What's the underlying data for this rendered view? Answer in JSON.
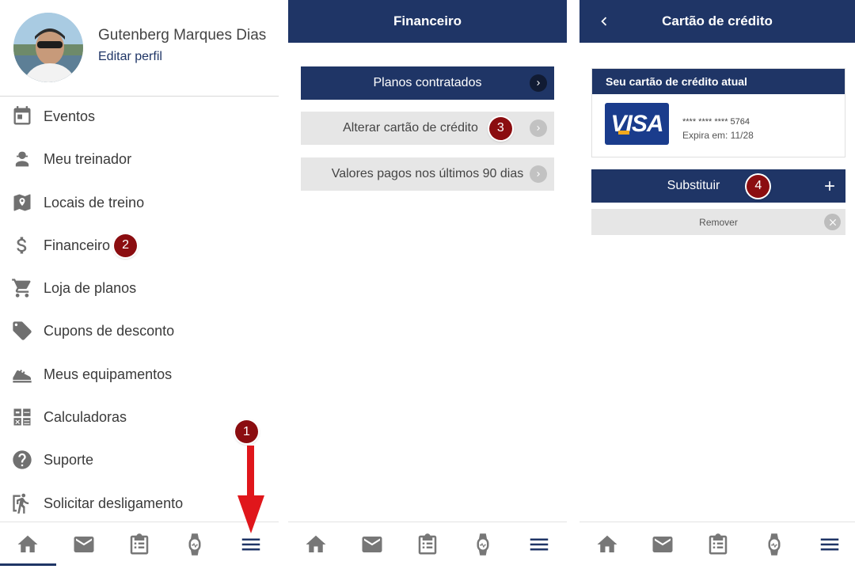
{
  "panel1": {
    "user_name": "Gutenberg Marques Dias",
    "edit_profile": "Editar perfil",
    "menu": [
      {
        "label": "Eventos",
        "icon": "calendar-icon"
      },
      {
        "label": "Meu treinador",
        "icon": "trainer-icon"
      },
      {
        "label": "Locais de treino",
        "icon": "map-pin-icon"
      },
      {
        "label": "Financeiro",
        "icon": "dollar-icon",
        "step": "2"
      },
      {
        "label": "Loja de planos",
        "icon": "cart-icon"
      },
      {
        "label": "Cupons de desconto",
        "icon": "tag-icon"
      },
      {
        "label": "Meus equipamentos",
        "icon": "shoe-icon"
      },
      {
        "label": "Calculadoras",
        "icon": "calculator-icon"
      },
      {
        "label": "Suporte",
        "icon": "help-icon"
      },
      {
        "label": "Solicitar desligamento",
        "icon": "exit-icon"
      }
    ],
    "step_menu": "1"
  },
  "panel2": {
    "title": "Financeiro",
    "buttons": [
      {
        "label": "Planos contratados"
      },
      {
        "label": "Alterar cartão de crédito",
        "step": "3"
      },
      {
        "label": "Valores pagos nos últimos 90 dias"
      }
    ]
  },
  "panel3": {
    "title": "Cartão de crédito",
    "card_section_title": "Seu cartão de crédito atual",
    "card_brand": "VISA",
    "card_number": "**** **** **** 5764",
    "card_expiry": "Expira em: 11/28",
    "replace_label": "Substituir",
    "replace_step": "4",
    "remove_label": "Remover"
  },
  "bottom_nav": [
    "home-icon",
    "mail-icon",
    "clipboard-icon",
    "watch-icon",
    "menu-icon"
  ],
  "colors": {
    "primary": "#1f3566",
    "badge": "#8b0d10",
    "arrow": "#e0161b",
    "light_button": "#e6e6e6"
  }
}
